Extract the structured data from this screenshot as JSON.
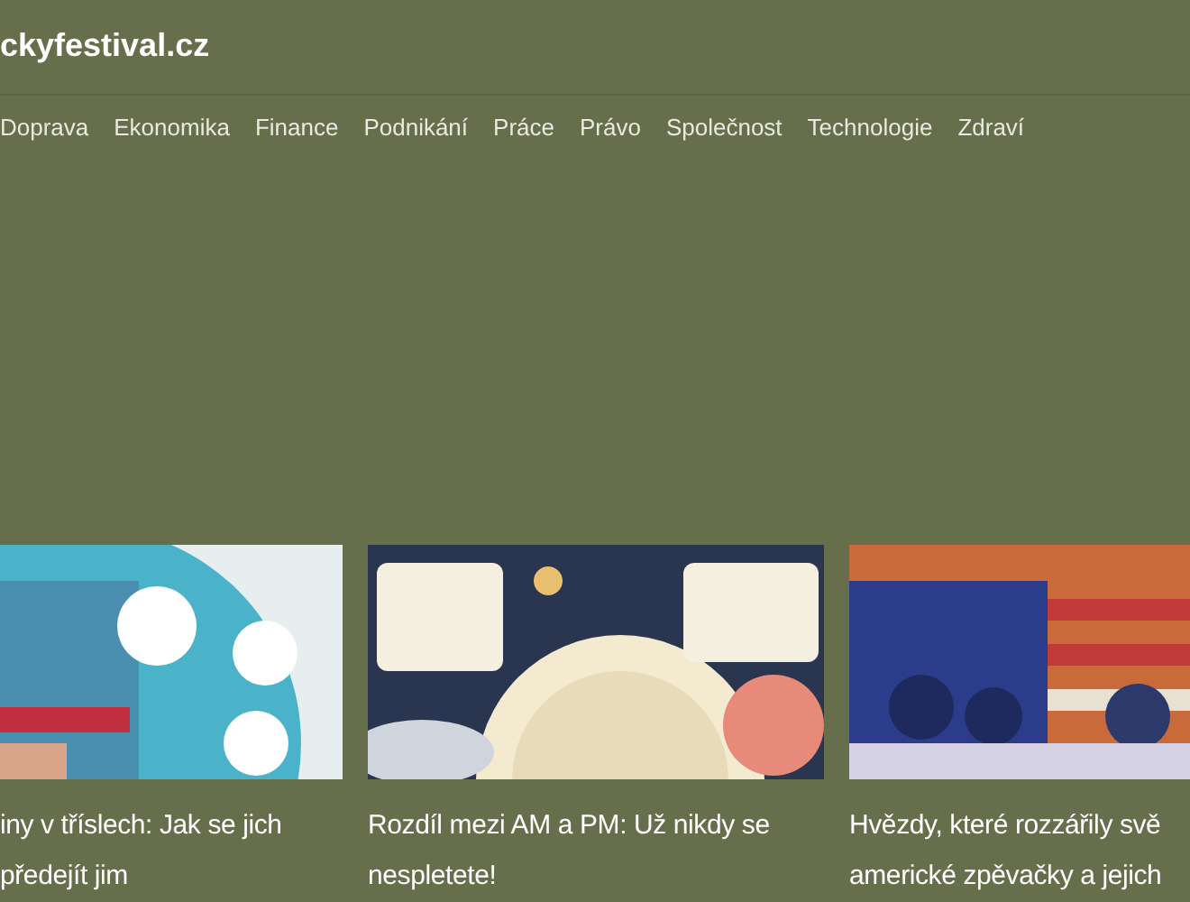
{
  "site": {
    "logo": "ckyfestival.cz"
  },
  "nav": [
    "Doprava",
    "Ekonomika",
    "Finance",
    "Podnikání",
    "Práce",
    "Právo",
    "Společnost",
    "Technologie",
    "Zdraví"
  ],
  "articles": [
    {
      "kind": "picture",
      "title_lines": [
        "iny v tříslech: Jak se jich",
        "předejít jim"
      ]
    },
    {
      "kind": "picture",
      "title_lines": [
        "Rozdíl mezi AM a PM: Už nikdy se",
        "nespletete!"
      ]
    },
    {
      "kind": "picture",
      "title_lines": [
        "Hvězdy, které rozzářily svě",
        "americké zpěvačky a jejich"
      ]
    }
  ]
}
